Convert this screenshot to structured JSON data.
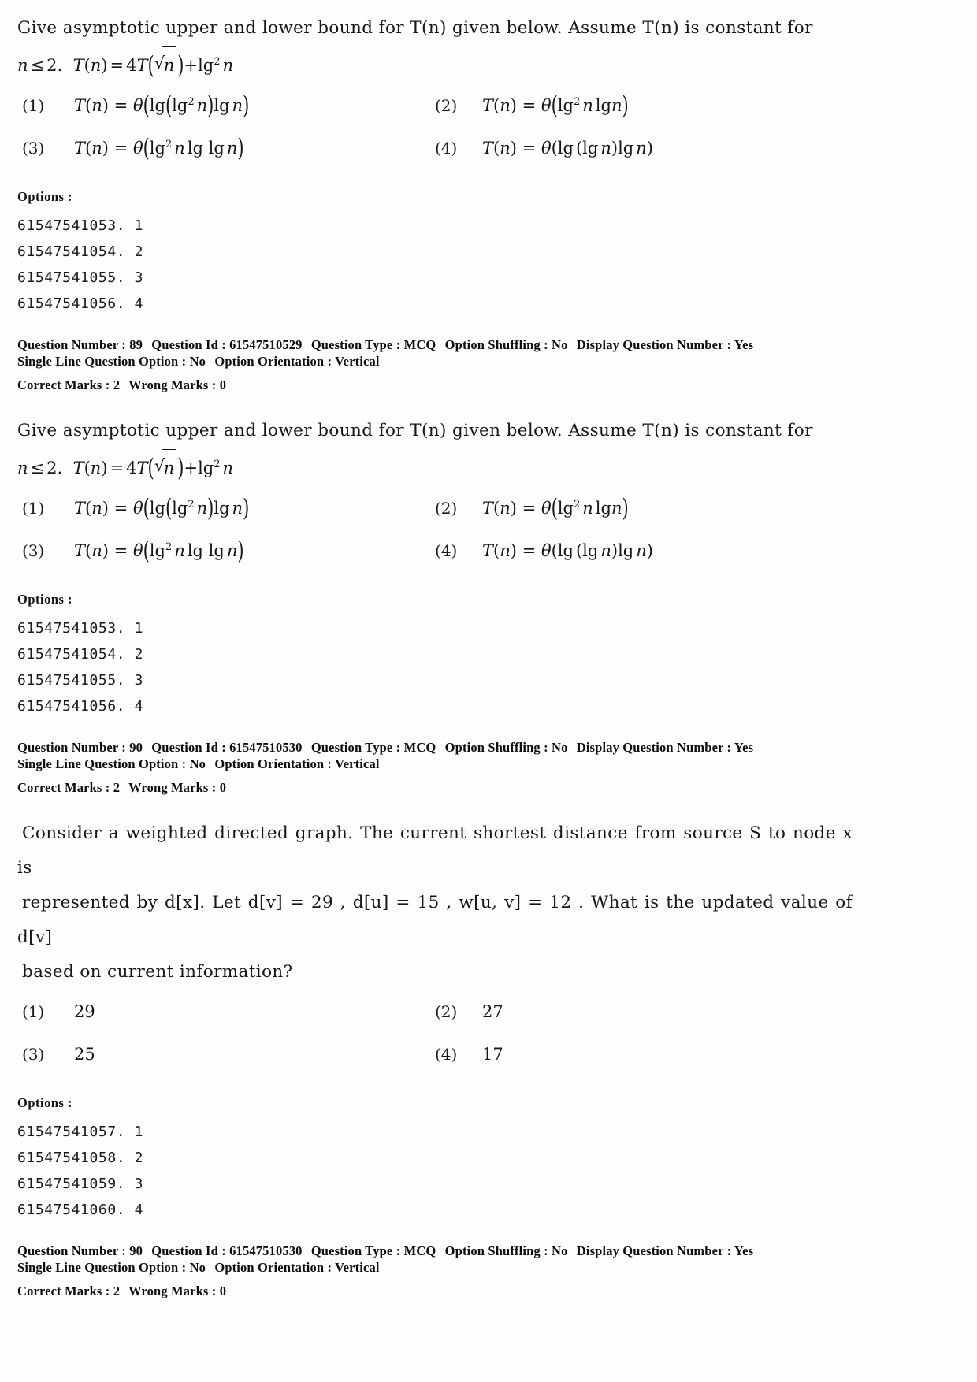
{
  "document": {
    "type": "exam-question-paper",
    "page_background": "#ffffff",
    "text_color": "#15151a"
  },
  "labels": {
    "options_heading": "Options :",
    "question_number_label": "Question Number :",
    "question_id_label": "Question Id :",
    "question_type_label": "Question Type :",
    "option_shuffling_label": "Option Shuffling :",
    "display_question_number_label": "Display Question Number :",
    "single_line_question_option_label": "Single Line Question Option :",
    "option_orientation_label": "Option Orientation :",
    "correct_marks_label": "Correct Marks :",
    "wrong_marks_label": "Wrong Marks :"
  },
  "blocks": [
    {
      "id": "block-1",
      "statement_line1": "Give asymptotic upper and lower bound for T(n) given below. Assume T(n) is constant for",
      "statement_line2_text": "n ≤ 2 . T(n) = 4T(√n) + lg² n",
      "choices": [
        {
          "num": "(1)",
          "text": "T(n) = θ(lg(lg² n)lg n)"
        },
        {
          "num": "(2)",
          "text": "T(n) = θ(lg² n lg n)"
        },
        {
          "num": "(3)",
          "text": "T(n) = θ(lg² n lg lg n)"
        },
        {
          "num": "(4)",
          "text": "T(n) = θ(lg(lg n)lg n)"
        }
      ],
      "option_ids": [
        "61547541053. 1",
        "61547541054. 2",
        "61547541055. 3",
        "61547541056. 4"
      ],
      "meta": {
        "question_number": "89",
        "question_id": "61547510529",
        "question_type": "MCQ",
        "option_shuffling": "No",
        "display_question_number": "Yes",
        "single_line_question_option": "No",
        "option_orientation": "Vertical",
        "correct_marks": "2",
        "wrong_marks": "0"
      }
    },
    {
      "id": "block-2",
      "statement_line1": "Give asymptotic upper and lower bound for T(n) given below. Assume T(n) is constant for",
      "statement_line2_text": "n ≤ 2 . T(n) = 4T(√n) + lg² n",
      "choices": [
        {
          "num": "(1)",
          "text": "T(n) = θ(lg(lg² n)lg n)"
        },
        {
          "num": "(2)",
          "text": "T(n) = θ(lg² n lg n)"
        },
        {
          "num": "(3)",
          "text": "T(n) = θ(lg² n lg lg n)"
        },
        {
          "num": "(4)",
          "text": "T(n) = θ(lg(lg n)lg n)"
        }
      ],
      "option_ids": [
        "61547541053. 1",
        "61547541054. 2",
        "61547541055. 3",
        "61547541056. 4"
      ],
      "meta": {
        "question_number": "90",
        "question_id": "61547510530",
        "question_type": "MCQ",
        "option_shuffling": "No",
        "display_question_number": "Yes",
        "single_line_question_option": "No",
        "option_orientation": "Vertical",
        "correct_marks": "2",
        "wrong_marks": "0"
      }
    },
    {
      "id": "block-3",
      "statement_line1": "Consider a weighted directed graph. The current shortest distance from source S to node x is",
      "statement_line2": "represented by d[x]. Let d[v] = 29 , d[u] = 15 , w[u, v] = 12 . What is the updated value of d[v]",
      "statement_line3": "based on current information?",
      "choices": [
        {
          "num": "(1)",
          "text": "29"
        },
        {
          "num": "(2)",
          "text": "27"
        },
        {
          "num": "(3)",
          "text": "25"
        },
        {
          "num": "(4)",
          "text": "17"
        }
      ],
      "option_ids": [
        "61547541057. 1",
        "61547541058. 2",
        "61547541059. 3",
        "61547541060. 4"
      ],
      "meta": {
        "question_number": "90",
        "question_id": "61547510530",
        "question_type": "MCQ",
        "option_shuffling": "No",
        "display_question_number": "Yes",
        "single_line_question_option": "No",
        "option_orientation": "Vertical",
        "correct_marks": "2",
        "wrong_marks": "0"
      }
    }
  ]
}
